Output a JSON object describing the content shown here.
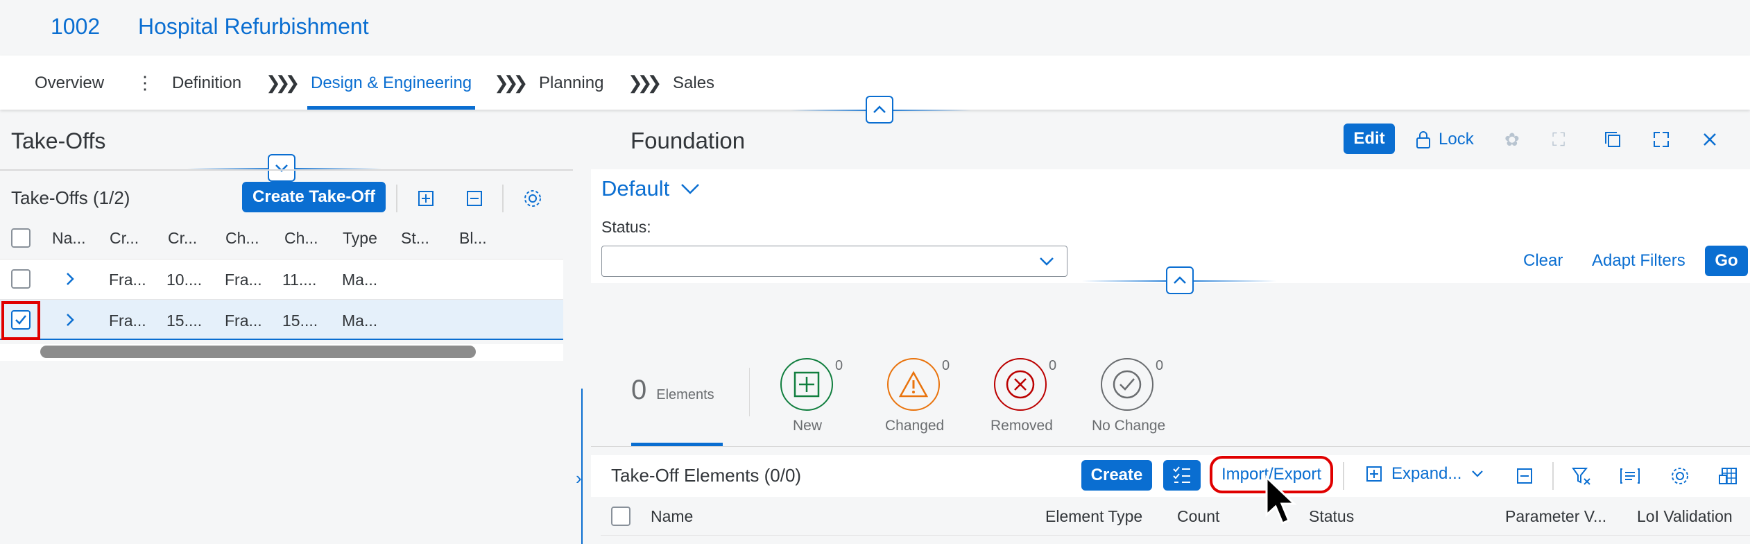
{
  "header": {
    "id": "1002",
    "title": "Hospital Refurbishment"
  },
  "tabs": [
    {
      "label": "Overview"
    },
    {
      "label": "Definition"
    },
    {
      "label": "Design & Engineering"
    },
    {
      "label": "Planning"
    },
    {
      "label": "Sales"
    }
  ],
  "left": {
    "title": "Take-Offs",
    "table_title": "Take-Offs (1/2)",
    "create_label": "Create Take-Off",
    "columns": [
      "Na...",
      "Cr...",
      "Cr...",
      "Ch...",
      "Ch...",
      "Type",
      "St...",
      "Bl..."
    ],
    "rows": [
      {
        "c1": "Fra...",
        "c2": "10....",
        "c3": "Fra...",
        "c4": "11....",
        "type": "Ma..."
      },
      {
        "c1": "Fra...",
        "c2": "15....",
        "c3": "Fra...",
        "c4": "15....",
        "type": "Ma..."
      }
    ]
  },
  "right": {
    "title": "Foundation",
    "edit_label": "Edit",
    "lock_label": "Lock",
    "variant": "Default",
    "status_label": "Status:",
    "status_value": "",
    "clear_label": "Clear",
    "adapt_label": "Adapt Filters",
    "go_label": "Go",
    "elements_count": "0",
    "elements_label": "Elements",
    "kpis": [
      {
        "label": "New",
        "count": "0",
        "color": "#107e3e"
      },
      {
        "label": "Changed",
        "count": "0",
        "color": "#e9730c"
      },
      {
        "label": "Removed",
        "count": "0",
        "color": "#bb0000"
      },
      {
        "label": "No Change",
        "count": "0",
        "color": "#6a6d70"
      }
    ],
    "elements_table": {
      "title": "Take-Off Elements (0/0)",
      "create_label": "Create",
      "import_label": "Import/Export",
      "expand_label": "Expand...",
      "columns": [
        "Name",
        "Element Type",
        "Count",
        "Status",
        "Parameter V...",
        "LoI Validation"
      ]
    }
  }
}
